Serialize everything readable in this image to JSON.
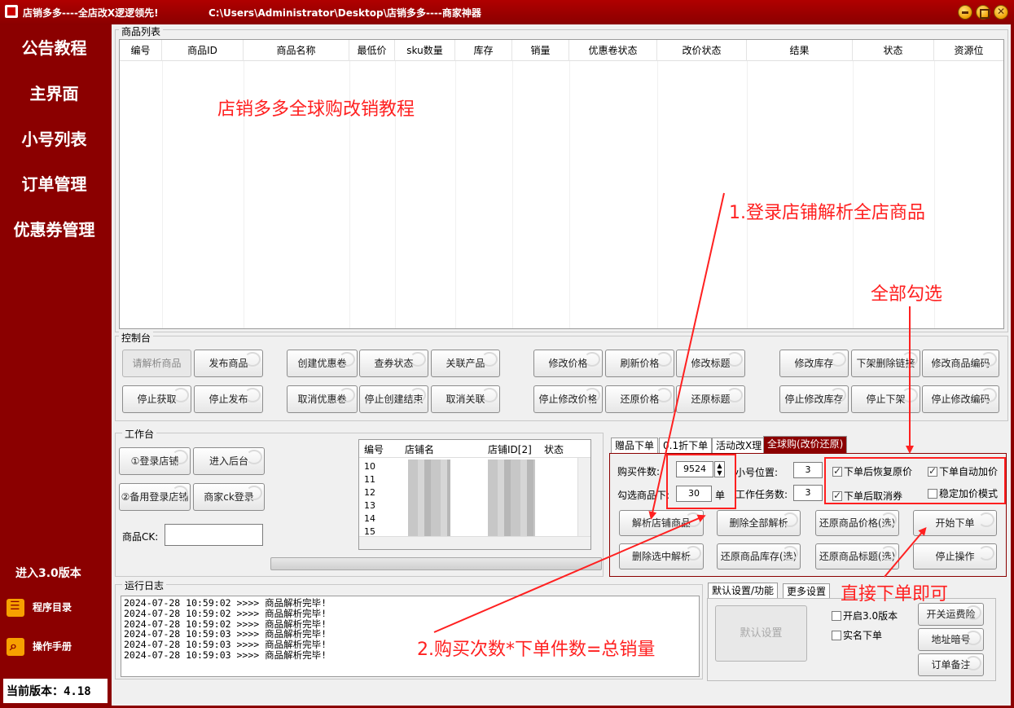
{
  "window": {
    "title_left": "店销多多----全店改X逻逻领先!",
    "title_path": "C:\\Users\\Administrator\\Desktop\\店销多多----商家神器"
  },
  "sidebar": {
    "items": [
      "公告教程",
      "主界面",
      "小号列表",
      "订单管理",
      "优惠券管理"
    ],
    "enter_v3": "进入3.0版本",
    "program_dir": "程序目录",
    "manual": "操作手册",
    "version": "当前版本：4.18"
  },
  "product_list": {
    "title": "商品列表",
    "columns": [
      "编号",
      "商品ID",
      "商品名称",
      "最低价",
      "sku数量",
      "库存",
      "销量",
      "优惠卷状态",
      "改价状态",
      "结果",
      "状态",
      "资源位"
    ]
  },
  "console": {
    "title": "控制台",
    "row1": [
      "请解析商品",
      "发布商品",
      "创建优惠卷",
      "查券状态",
      "关联产品",
      "修改价格",
      "刷新价格",
      "修改标题",
      "修改库存",
      "下架删除链接",
      "修改商品编码"
    ],
    "row2": [
      "停止获取",
      "停止发布",
      "取消优惠卷",
      "停止创建结束",
      "取消关联",
      "停止修改价格",
      "还原价格",
      "还原标题",
      "停止修改库存",
      "停止下架",
      "停止修改编码"
    ]
  },
  "workbench": {
    "title": "工作台",
    "login_store": "①登录店铺",
    "enter_backend": "进入后台",
    "backup_login": "②备用登录店铺",
    "merchant_ck_login": "商家ck登录",
    "product_ck_label": "商品CK:",
    "product_ck_value": "",
    "store_list": {
      "columns": [
        "编号",
        "店铺名",
        "店铺ID[2]",
        "状态"
      ],
      "rows": [
        "10",
        "11",
        "12",
        "13",
        "14",
        "15"
      ]
    }
  },
  "tabs": [
    "赠品下单",
    "0.1折下单",
    "活动改X理",
    "全球购(改价还原)"
  ],
  "global_buy": {
    "buy_count_label": "购买件数:",
    "buy_count_value": "9524",
    "select_orders_label": "勾选商品下:",
    "select_orders_value": "30",
    "unit_orders": "单",
    "alt_pos_label": "小号位置:",
    "alt_pos_value": "3",
    "work_tasks_label": "工作任务数:",
    "work_tasks_value": "3",
    "checkboxes": [
      {
        "label": "下单后恢复原价",
        "checked": true
      },
      {
        "label": "下单自动加价",
        "checked": true
      },
      {
        "label": "下单后取消券",
        "checked": true
      },
      {
        "label": "稳定加价模式",
        "checked": false
      }
    ],
    "buttons": [
      "解析店铺商品",
      "删除全部解析",
      "还原商品价格(选)",
      "开始下单",
      "删除选中解析",
      "还原商品库存(选)",
      "还原商品标题(选)",
      "停止操作"
    ]
  },
  "log": {
    "title": "运行日志",
    "lines": [
      "2024-07-28 10:59:02 >>>> 商品解析完毕!",
      "2024-07-28 10:59:02 >>>> 商品解析完毕!",
      "2024-07-28 10:59:02 >>>> 商品解析完毕!",
      "2024-07-28 10:59:03 >>>> 商品解析完毕!",
      "2024-07-28 10:59:03 >>>> 商品解析完毕!",
      "2024-07-28 10:59:03 >>>> 商品解析完毕!"
    ]
  },
  "settings": {
    "tabs": [
      "默认设置/功能",
      "更多设置"
    ],
    "default_btn": "默认设置",
    "enable_v3": "开启3.0版本",
    "real_name": "实名下单",
    "btn_shipping": "开关运费险",
    "btn_address": "地址暗号",
    "btn_order_note": "订单备注"
  },
  "annotations": {
    "tutorial": "店销多多全球购改销教程",
    "step1": "1.登录店铺解析全店商品",
    "select_all": "全部勾选",
    "direct_order": "直接下单即可",
    "step2": "2.购买次数*下单件数=总销量"
  },
  "colors": {
    "accent": "#8b0000",
    "annotation": "#ff2020"
  }
}
